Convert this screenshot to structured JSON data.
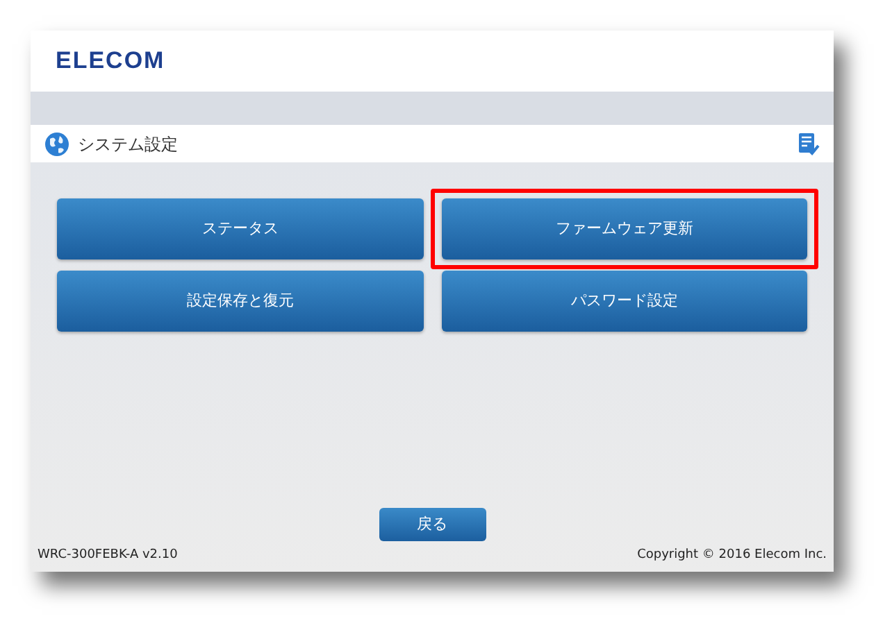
{
  "header": {
    "logo": "ELECOM"
  },
  "title_bar": {
    "title": "システム設定"
  },
  "menu_buttons": [
    {
      "label": "ステータス",
      "highlighted": false
    },
    {
      "label": "ファームウェア更新",
      "highlighted": true
    },
    {
      "label": "設定保存と復元",
      "highlighted": false
    },
    {
      "label": "パスワード設定",
      "highlighted": false
    }
  ],
  "back_button": {
    "label": "戻る"
  },
  "footer": {
    "model": "WRC-300FEBK-A v2.10",
    "copyright": "Copyright © 2016 Elecom Inc."
  }
}
